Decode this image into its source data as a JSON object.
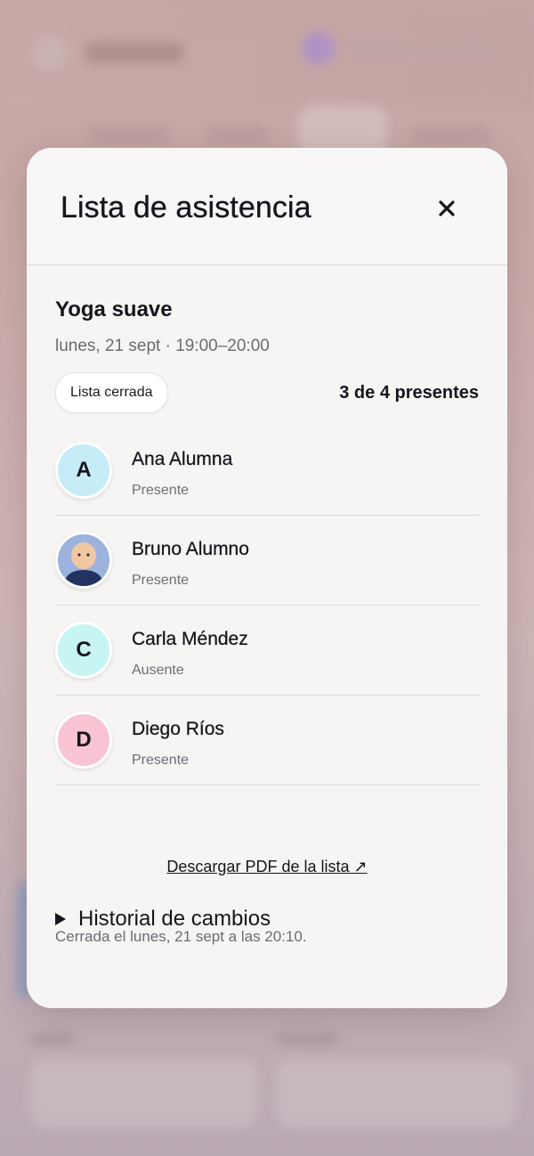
{
  "modal": {
    "title": "Lista de asistencia",
    "close_icon": "close-icon"
  },
  "session": {
    "class_name": "Yoga suave",
    "datetime": "lunes, 21 sept · 19:00–20:00",
    "status_pill": "Lista cerrada",
    "present_count": "3 de 4 presentes"
  },
  "attendees": [
    {
      "name": "Ana Alumna",
      "status": "Presente",
      "initial": "A",
      "avatar_color": "#c6ecf8",
      "avatar_type": "initial"
    },
    {
      "name": "Bruno Alumno",
      "status": "Presente",
      "initial": "",
      "avatar_color": "#8ea7d6",
      "avatar_type": "photo"
    },
    {
      "name": "Carla Méndez",
      "status": "Ausente",
      "initial": "C",
      "avatar_color": "#c7f5f3",
      "avatar_type": "initial"
    },
    {
      "name": "Diego Ríos",
      "status": "Presente",
      "initial": "D",
      "avatar_color": "#f8c3d3",
      "avatar_type": "initial"
    }
  ],
  "footer": {
    "closed_note": "Cerrada el lunes, 21 sept a las 20:10.",
    "download_link": "Descargar PDF de la lista ↗",
    "history_label": "Historial de cambios"
  }
}
